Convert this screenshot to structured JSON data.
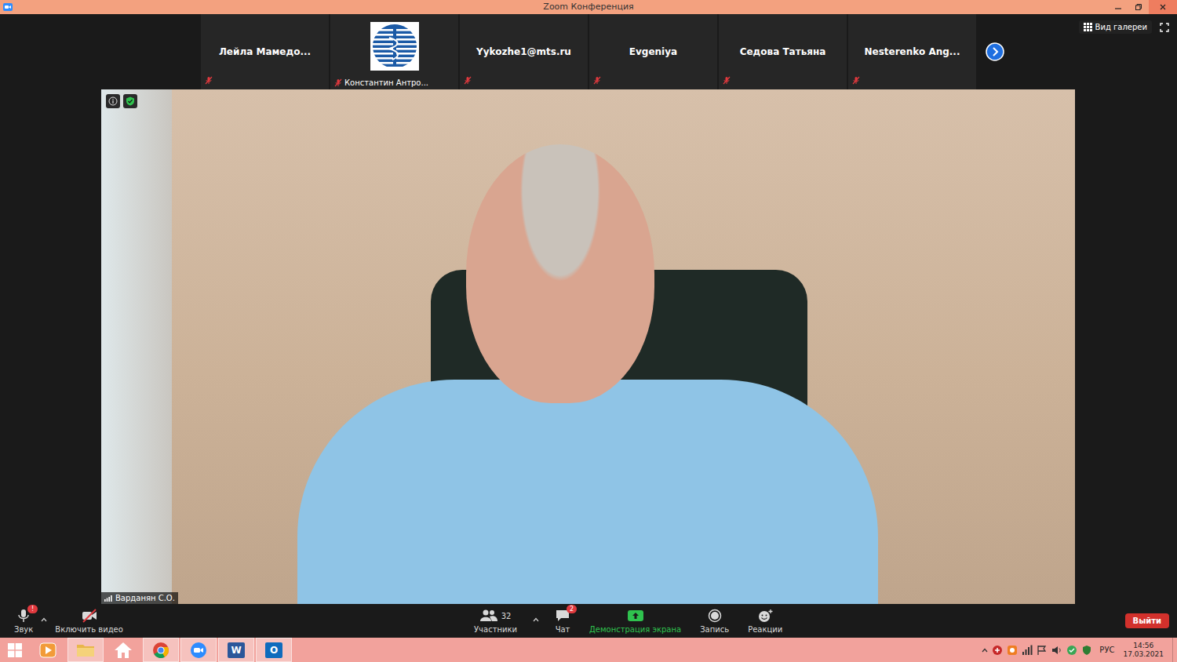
{
  "window": {
    "title": "Zoom Конференция"
  },
  "gallery_button": {
    "label": "Вид галереи"
  },
  "participants_strip": [
    {
      "kind": "name",
      "name": "Лейла Мамедо...",
      "muted": true
    },
    {
      "kind": "logo",
      "name": "Константин Антро...",
      "muted": true
    },
    {
      "kind": "name",
      "name": "Yykozhe1@mts.ru",
      "muted": true
    },
    {
      "kind": "name",
      "name": "Evgeniya",
      "muted": true
    },
    {
      "kind": "name",
      "name": "Седова Татьяна",
      "muted": true
    },
    {
      "kind": "name",
      "name": "Nesterenko Ang...",
      "muted": true
    }
  ],
  "speaker": {
    "name": "Варданян С.О."
  },
  "toolbar": {
    "left": [
      {
        "kind": "audio",
        "label": "Звук",
        "badge": "!",
        "count": "",
        "caret": true,
        "color": "#d9d9d9"
      },
      {
        "kind": "video",
        "label": "Включить видео",
        "badge": "",
        "count": "",
        "caret": false,
        "color": "#d9d9d9"
      }
    ],
    "center": [
      {
        "kind": "participants",
        "label": "Участники",
        "badge": "",
        "count": "32",
        "caret": true,
        "color": "#d9d9d9"
      },
      {
        "kind": "chat",
        "label": "Чат",
        "badge": "2",
        "count": "",
        "caret": false,
        "color": "#d9d9d9"
      },
      {
        "kind": "share",
        "label": "Демонстрация экрана",
        "badge": "",
        "count": "",
        "caret": false,
        "color": "#2fc24e"
      },
      {
        "kind": "record",
        "label": "Запись",
        "badge": "",
        "count": "",
        "caret": false,
        "color": "#d9d9d9"
      },
      {
        "kind": "reactions",
        "label": "Реакции",
        "badge": "",
        "count": "",
        "caret": false,
        "color": "#d9d9d9"
      }
    ],
    "leave": "Выйти"
  },
  "taskbar": {
    "apps": [
      {
        "kind": "media",
        "open": false,
        "glyph": ""
      },
      {
        "kind": "explorer",
        "open": true,
        "glyph": ""
      },
      {
        "kind": "home",
        "open": false,
        "glyph": ""
      },
      {
        "kind": "chrome",
        "open": true,
        "glyph": ""
      },
      {
        "kind": "zoom",
        "open": true,
        "glyph": ""
      },
      {
        "kind": "word",
        "open": true,
        "glyph": "W"
      },
      {
        "kind": "outlook",
        "open": true,
        "glyph": "O"
      }
    ],
    "language": "РУС",
    "time": "14:56",
    "date": "17.03.2021"
  }
}
